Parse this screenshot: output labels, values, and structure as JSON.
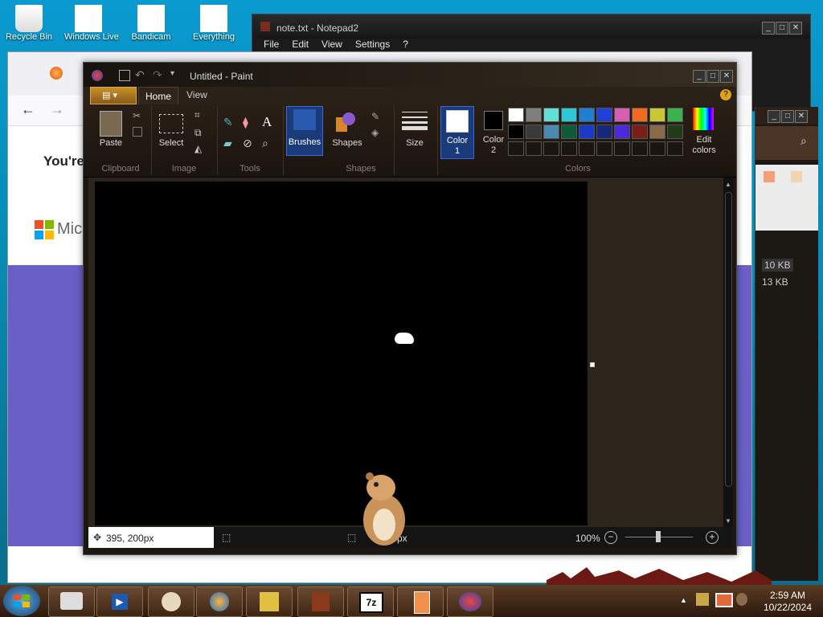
{
  "desktop": {
    "icons": [
      {
        "label": "Recycle Bin",
        "name": "recycle-bin"
      },
      {
        "label": "Windows Live",
        "name": "windows-live"
      },
      {
        "label": "Bandicam",
        "name": "bandicam"
      },
      {
        "label": "Everything",
        "name": "everything"
      }
    ]
  },
  "notepad": {
    "title": "note.txt - Notepad2",
    "menu": [
      "File",
      "Edit",
      "View",
      "Settings",
      "?"
    ]
  },
  "browser": {
    "heading": "You're",
    "logo_text": "Mic"
  },
  "explorer": {
    "sizes": [
      "10 KB",
      "13 KB"
    ]
  },
  "paint": {
    "title": "Untitled - Paint",
    "tabs": [
      "Home",
      "View"
    ],
    "groups": {
      "clipboard": "Clipboard",
      "image": "Image",
      "tools": "Tools",
      "shapes": "Shapes",
      "colors": "Colors"
    },
    "buttons": {
      "paste": "Paste",
      "select": "Select",
      "brushes": "Brushes",
      "shapes": "Shapes",
      "size": "Size",
      "color1": "Color\n1",
      "color2": "Color\n2",
      "edit_colors": "Edit\ncolors"
    },
    "palette_row1": [
      "#ffffff",
      "#7f7f7f",
      "#62e0d8",
      "#2ec8d6",
      "#1e7fd4",
      "#1f3fd8",
      "#d85fb0",
      "#f06a22",
      "#c8c832",
      "#3ab44a"
    ],
    "palette_row2": [
      "#000000",
      "#3a3a3a",
      "#4a8ab0",
      "#0f5a3a",
      "#1a3ac8",
      "#16287a",
      "#4a2ad8",
      "#7a1f18",
      "#8a6a4a",
      "#203a1a"
    ],
    "color1": "#ffffff",
    "color2": "#000000",
    "status": {
      "position": "395, 200px",
      "size": "px",
      "zoom": "100%"
    }
  },
  "taskbar": {
    "time": "2:59 AM",
    "date": "10/22/2024",
    "items": [
      "file-manager",
      "media-player",
      "app3",
      "firefox",
      "notes",
      "book",
      "7zip",
      "document",
      "paint"
    ]
  }
}
